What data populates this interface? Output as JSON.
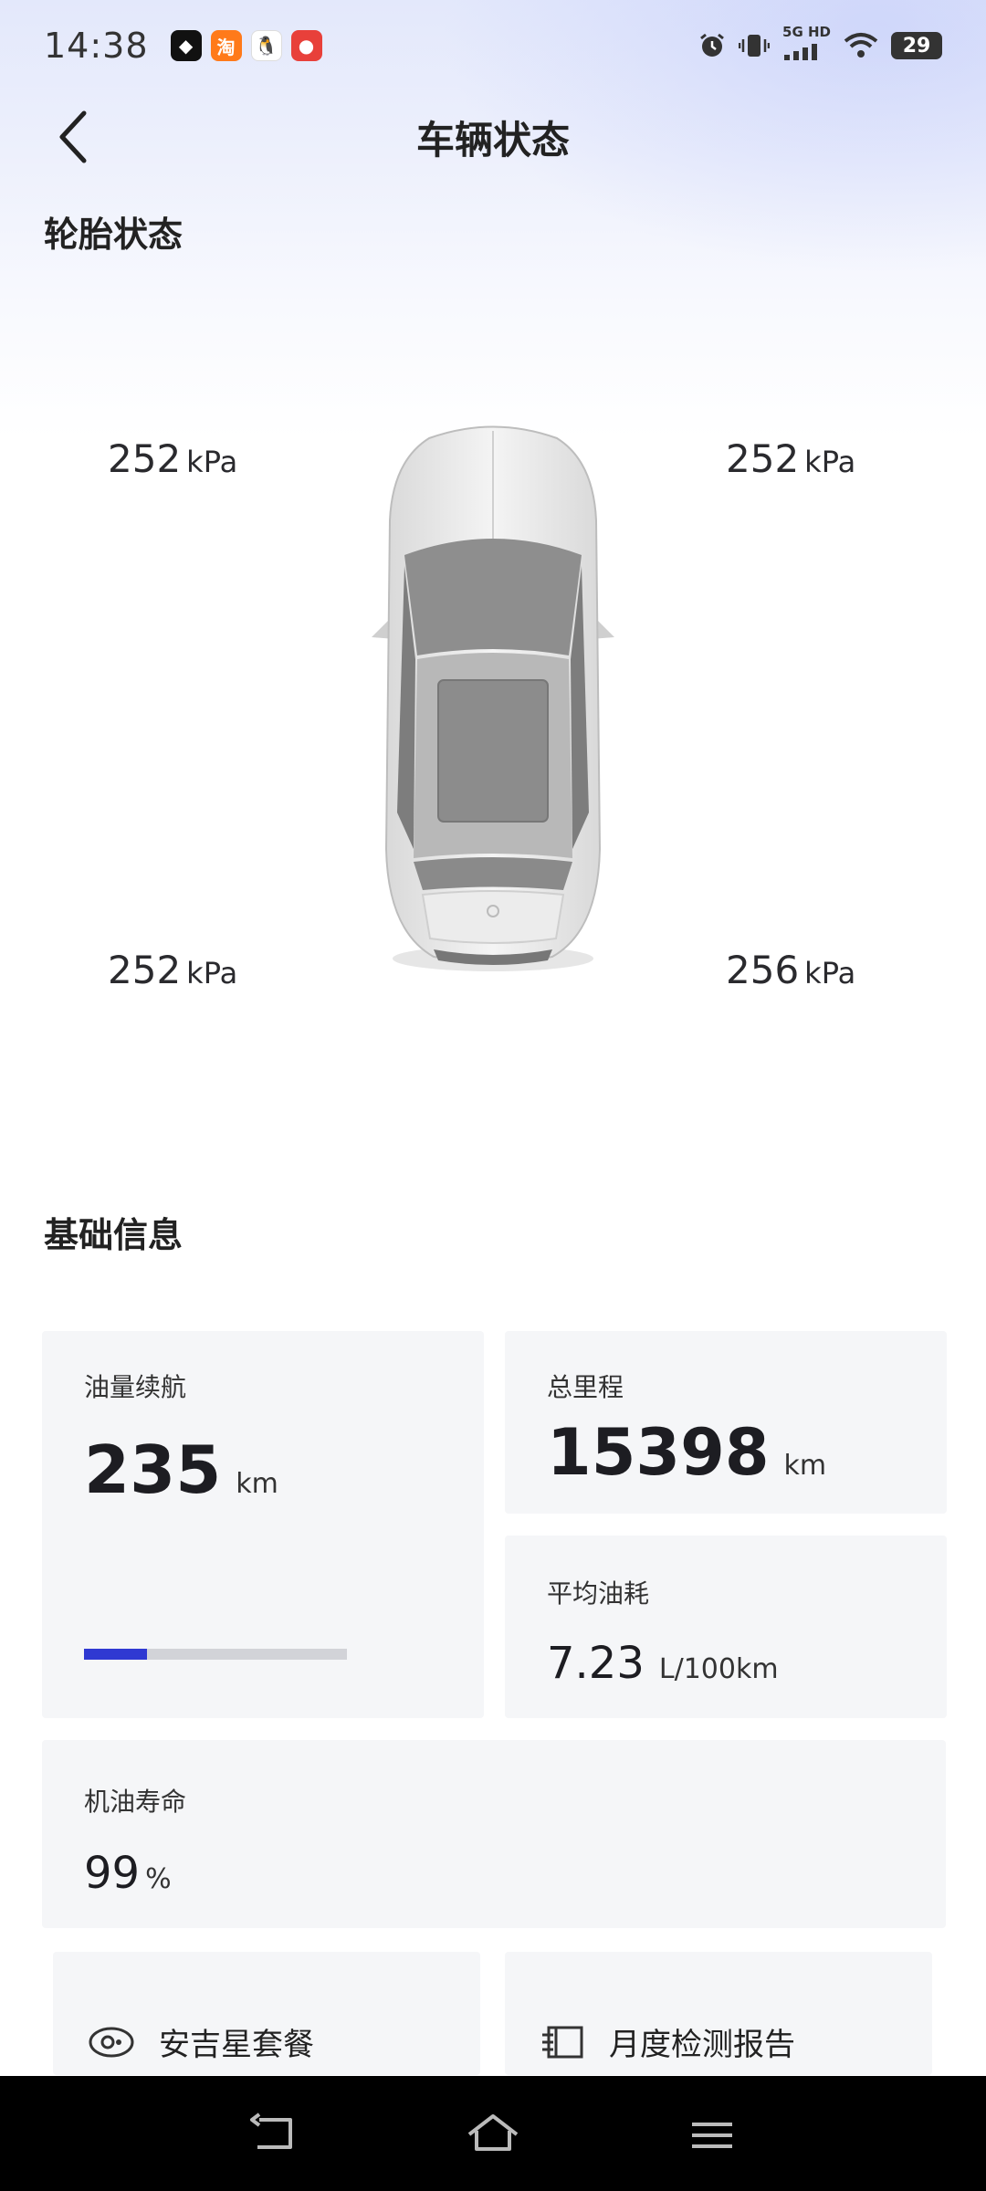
{
  "status_bar": {
    "time": "14:38",
    "network": "5G HD",
    "battery": "29"
  },
  "header": {
    "title": "车辆状态"
  },
  "tire_section": {
    "title": "轮胎状态",
    "front_left": {
      "value": "252",
      "unit": "kPa"
    },
    "front_right": {
      "value": "252",
      "unit": "kPa"
    },
    "rear_left": {
      "value": "252",
      "unit": "kPa"
    },
    "rear_right": {
      "value": "256",
      "unit": "kPa"
    }
  },
  "basic_section": {
    "title": "基础信息",
    "fuel_range": {
      "label": "油量续航",
      "value": "235",
      "unit": "km",
      "fuel_level_fraction": 0.24
    },
    "total_mileage": {
      "label": "总里程",
      "value": "15398",
      "unit": "km"
    },
    "avg_consumption": {
      "label": "平均油耗",
      "value": "7.23",
      "unit": "L/100km"
    },
    "oil_life": {
      "label": "机油寿命",
      "value": "99",
      "unit": "%"
    }
  },
  "links": {
    "package": {
      "label": "安吉星套餐",
      "icon": "eye-icon"
    },
    "report": {
      "label": "月度检测报告",
      "icon": "report-icon"
    }
  },
  "colors": {
    "accent": "#2f39d2",
    "card_bg": "#f5f6f8"
  }
}
